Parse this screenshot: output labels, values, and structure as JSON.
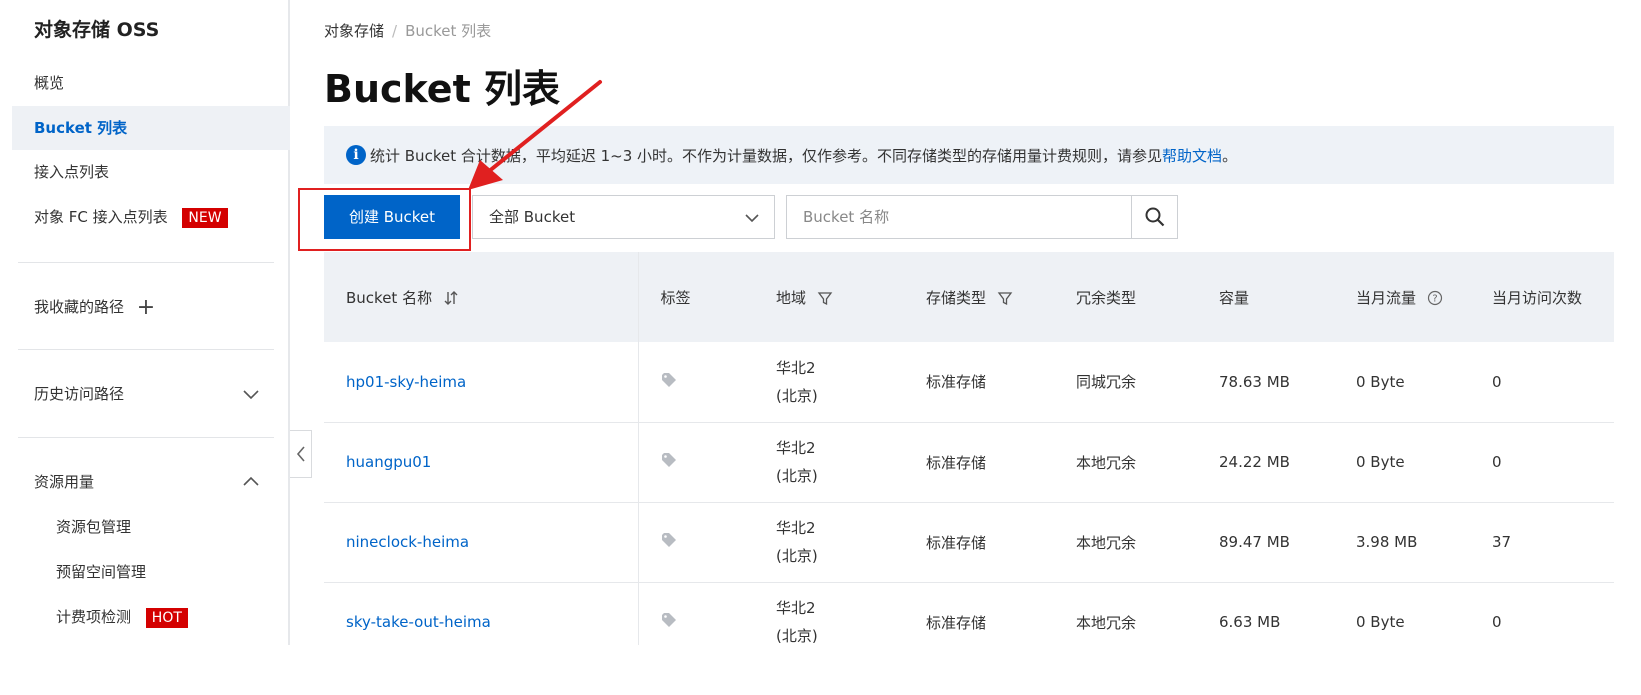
{
  "sidebar": {
    "brand": "对象存储 OSS",
    "items": [
      {
        "label": "概览"
      },
      {
        "label": "Bucket 列表"
      },
      {
        "label": "接入点列表"
      },
      {
        "label": "对象 FC 接入点列表",
        "badge": "NEW"
      }
    ],
    "favorites": "我收藏的路径",
    "history": "历史访问路径",
    "usage": "资源用量",
    "usage_items": [
      {
        "label": "资源包管理"
      },
      {
        "label": "预留空间管理"
      },
      {
        "label": "计费项检测",
        "badge": "HOT"
      }
    ],
    "badge_color": "#d40000"
  },
  "breadcrumb": {
    "root": "对象存储",
    "separator": "/",
    "current": "Bucket 列表"
  },
  "page_title": "Bucket 列表",
  "notice": {
    "text": "统计 Bucket 合计数据，平均延迟 1~3 小时。不作为计量数据，仅作参考。不同存储类型的存储用量计费规则，请参见",
    "link": "帮助文档",
    "end": "。"
  },
  "toolbar": {
    "create_label": "创建 Bucket",
    "filter_value": "全部 Bucket",
    "search_placeholder": "Bucket 名称"
  },
  "table": {
    "headers": {
      "name": "Bucket 名称",
      "tags": "标签",
      "region": "地域",
      "storage": "存储类型",
      "redundancy": "冗余类型",
      "capacity": "容量",
      "traffic": "当月流量",
      "requests": "当月访问次数"
    },
    "rows": [
      {
        "name": "hp01-sky-heima",
        "region_1": "华北2",
        "region_2": "(北京)",
        "storage": "标准存储",
        "redundancy": "同城冗余",
        "capacity": "78.63 MB",
        "traffic": "0 Byte",
        "requests": "0"
      },
      {
        "name": "huangpu01",
        "region_1": "华北2",
        "region_2": "(北京)",
        "storage": "标准存储",
        "redundancy": "本地冗余",
        "capacity": "24.22 MB",
        "traffic": "0 Byte",
        "requests": "0"
      },
      {
        "name": "nineclock-heima",
        "region_1": "华北2",
        "region_2": "(北京)",
        "storage": "标准存储",
        "redundancy": "本地冗余",
        "capacity": "89.47 MB",
        "traffic": "3.98 MB",
        "requests": "37"
      },
      {
        "name": "sky-take-out-heima",
        "region_1": "华北2",
        "region_2": "(北京)",
        "storage": "标准存储",
        "redundancy": "本地冗余",
        "capacity": "6.63 MB",
        "traffic": "0 Byte",
        "requests": "0"
      }
    ]
  },
  "colors": {
    "primary": "#0064c8",
    "annotation": "#e02020"
  }
}
